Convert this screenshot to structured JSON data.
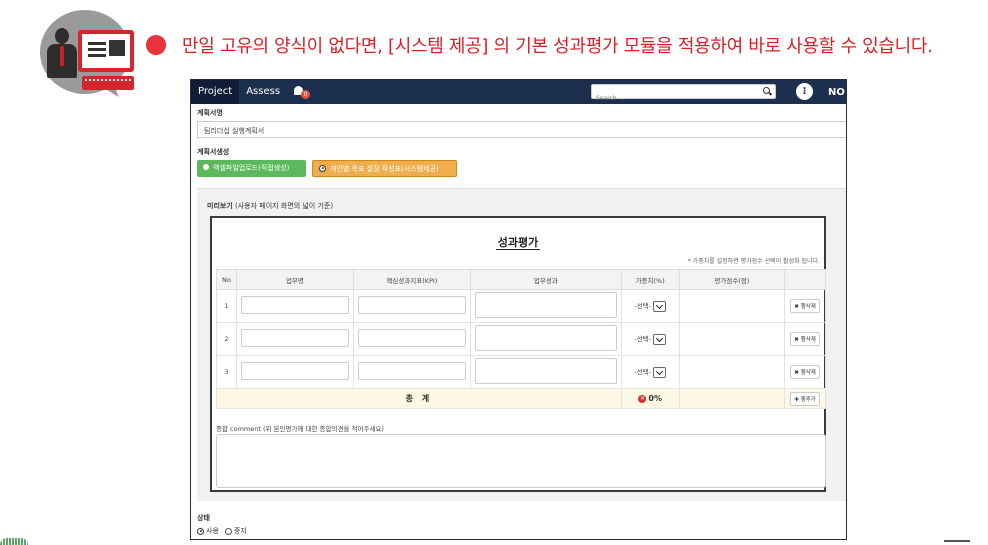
{
  "headline": "만일 고유의 양식이 없다면, [시스템 제공] 의 기본 성과평가 모듈을 적용하여 바로 사용할 수 있습니다.",
  "navbar": {
    "tabs": [
      "Project",
      "Assess"
    ],
    "badge_count": "0",
    "search_placeholder": "Search ...",
    "kebab": "⁝",
    "brand": "NO"
  },
  "form": {
    "plan_name_label": "계획서명",
    "plan_name_value": "팀리더십 실행계획서",
    "creation_label": "계획서생성",
    "btn_excel": "엑셀파일업로드(직접생성)",
    "btn_system": "개인별 목표 설정 작성표(시스템제공)"
  },
  "preview": {
    "label_bold": "미리보기",
    "label_rest": " (사용자 페이지 화면의 넓이 기준)",
    "sheet_title": "성과평가",
    "note": "* 가중치를 설정하면 평가점수 선택이 활성화 됩니다.",
    "columns": [
      "No",
      "업무명",
      "핵심성과지표(KPI)",
      "업무성과",
      "가중치(%)",
      "평가점수(점)",
      ""
    ],
    "rows": [
      {
        "no": "1",
        "weight": "-선택-",
        "action": "행삭제"
      },
      {
        "no": "2",
        "weight": "-선택-",
        "action": "행삭제"
      },
      {
        "no": "3",
        "weight": "-선택-",
        "action": "행삭제"
      }
    ],
    "total_label": "총 계",
    "total_pct": "0%",
    "add_row": "행추가",
    "comment_label": "종합 comment (위 본인평가에 대한 종합의견을 적어주세요)"
  },
  "status": {
    "label": "상태",
    "options": [
      "사용",
      "중지"
    ],
    "selected": "사용"
  },
  "colors": {
    "headline": "#d91f26",
    "navbar": "#1d2f4f",
    "green_button": "#5cb85c",
    "orange_button": "#f0ad4e"
  }
}
